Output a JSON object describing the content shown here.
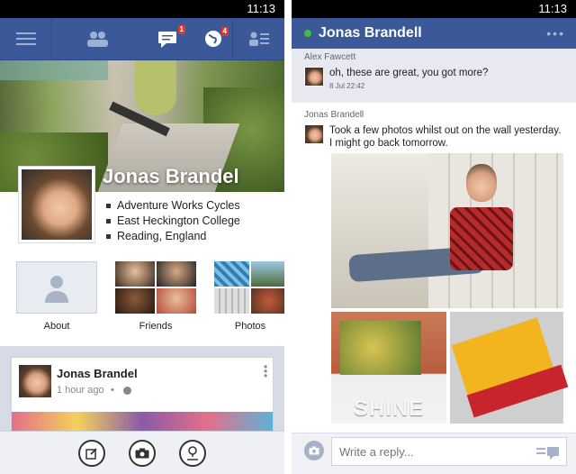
{
  "left": {
    "status_time": "11:13",
    "topbar": {
      "message_badge": "1",
      "notification_badge": "4"
    },
    "profile": {
      "name": "Jonas Brandel",
      "info": [
        "Adventure Works Cycles",
        "East Heckington College",
        "Reading, England"
      ]
    },
    "tiles": [
      {
        "label": "About"
      },
      {
        "label": "Friends"
      },
      {
        "label": "Photos"
      }
    ],
    "post": {
      "author": "Jonas Brandel",
      "time": "1 hour ago",
      "separator": "•"
    },
    "bottombar": {
      "icons": [
        "compose-icon",
        "camera-icon",
        "check-in-icon"
      ]
    }
  },
  "right": {
    "status_time": "11:13",
    "chat": {
      "title": "Jonas Brandell",
      "more": "•••",
      "messages": [
        {
          "sender": "Alex Fawcett",
          "text": "oh, these are great, you got more?",
          "date": "8 Jul 22:42"
        },
        {
          "sender": "Jonas Brandell",
          "text": "Took a few photos whilst out on the wall yesterday. I might go back tomorrow."
        }
      ],
      "photo_caption_word": "SHINE",
      "reply_placeholder": "Write a reply..."
    }
  },
  "colors": {
    "brand": "#3b5998",
    "online": "#3fbf3f",
    "badge": "#e0392b"
  }
}
